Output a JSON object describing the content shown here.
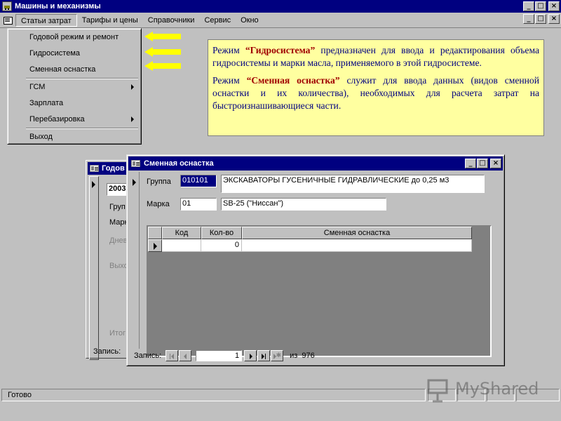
{
  "window": {
    "title": "Машины и механизмы",
    "btn_min": "_",
    "btn_max": "□",
    "btn_close": "×"
  },
  "menubar": {
    "items": [
      "Статьи затрат",
      "Тарифы и цены",
      "Справочники",
      "Сервис",
      "Окно"
    ]
  },
  "dropdown": {
    "items": [
      "Годовой режим и ремонт",
      "Гидросистема",
      "Сменная оснастка",
      "ГСМ",
      "Зарплата",
      "Перебазировка",
      "Выход"
    ]
  },
  "info": {
    "p1_prefix": "Режим ",
    "p1_bold": "“Гидросистема”",
    "p1_rest": " предназначен для ввода и редактирования объема гидросистемы и марки масла, применяемого в этой гидросистеме.",
    "p2_prefix": "Режим ",
    "p2_bold": "“Сменная оснастка”",
    "p2_rest": " служит для ввода данных (видов сменной оснастки и их количества), необходимых для расчета затрат на быстроизнашивающиеся части."
  },
  "bg_window": {
    "title": "Годов",
    "field_value": "2003",
    "labels": [
      "Груп",
      "Марк",
      "Днев",
      "Выхо",
      "Итог"
    ],
    "record_label": "Запись:"
  },
  "form": {
    "title": "Сменная оснастка",
    "group_label": "Группа",
    "group_code": "010101",
    "group_name": "ЭКСКАВАТОРЫ ГУСЕНИЧНЫЕ ГИДРАВЛИЧЕСКИЕ  до 0,25 м3",
    "brand_label": "Марка",
    "brand_code": "01",
    "brand_name": "SB-25 (\"Ниссан\")",
    "columns": [
      "Код",
      "Кол-во",
      "Сменная оснастка"
    ],
    "row": {
      "code": "",
      "qty": "0",
      "name": ""
    },
    "nav": {
      "label": "Запись:",
      "current": "1",
      "of_label": "из",
      "total": "976"
    }
  },
  "status": {
    "text": "Готово"
  },
  "watermark": {
    "text": "MyShared"
  },
  "colors": {
    "title_bar": "#000080",
    "info_bg": "#ffffa0",
    "info_text": "#000080",
    "info_bold": "#a00000",
    "arrow": "#ffff00"
  }
}
